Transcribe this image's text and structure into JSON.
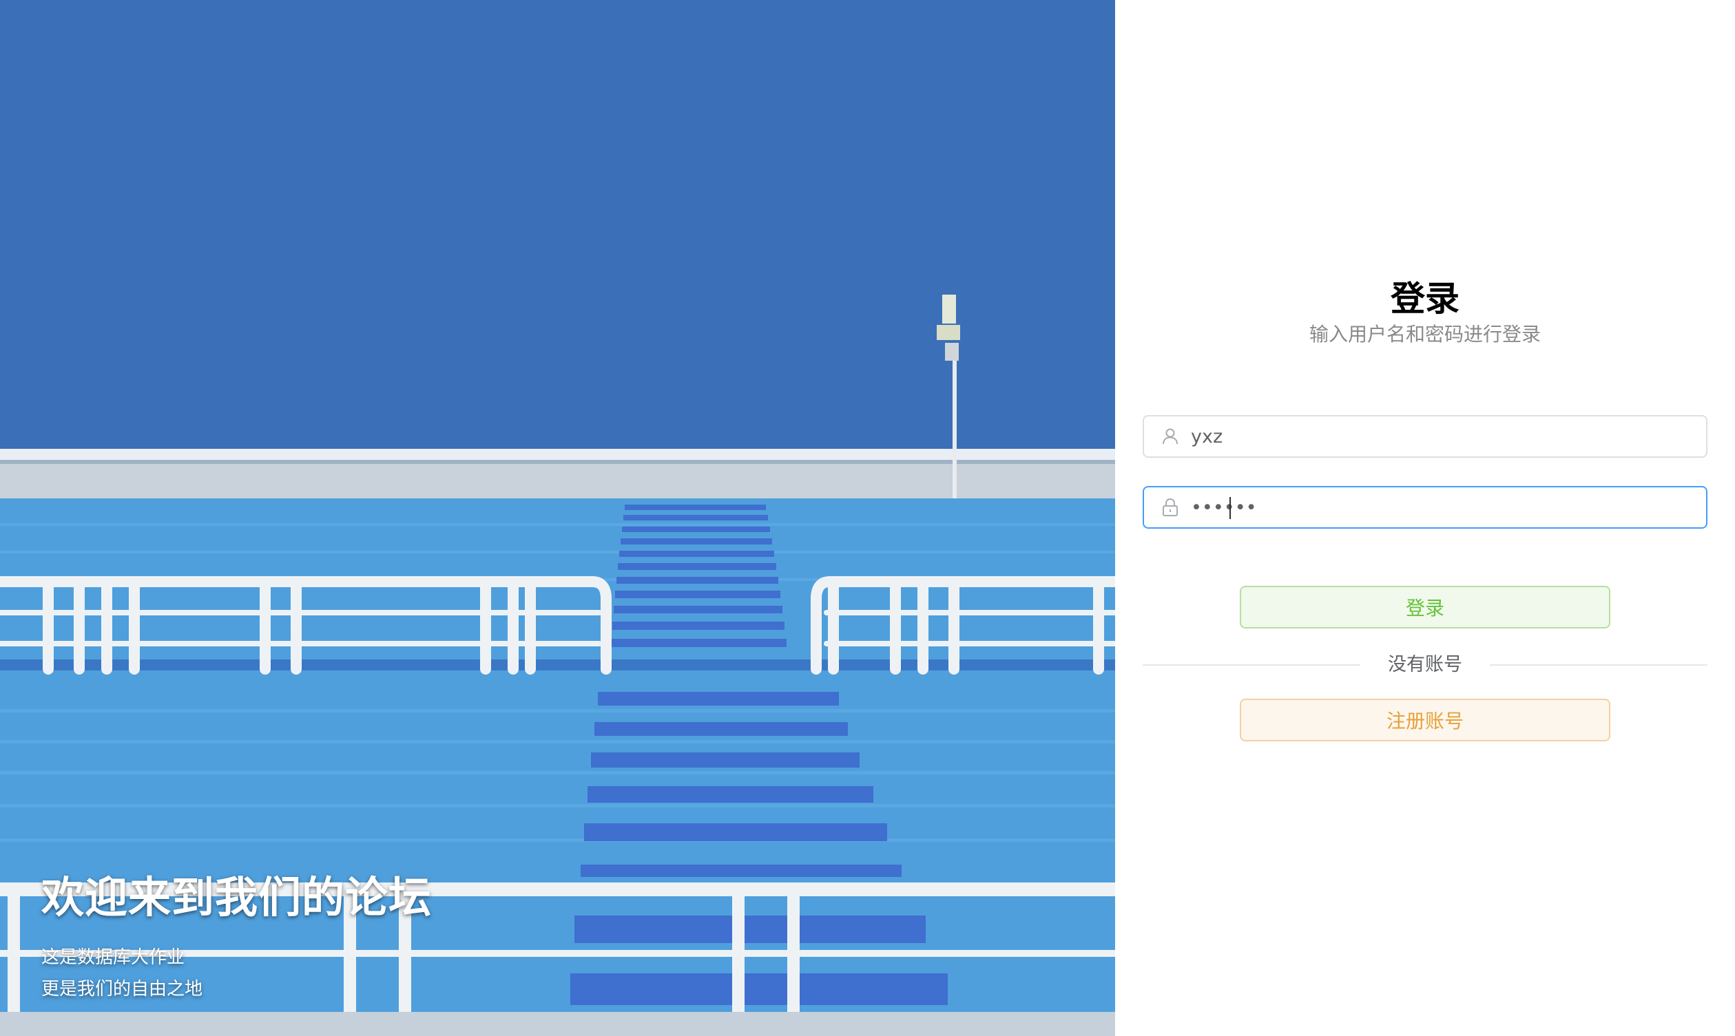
{
  "hero": {
    "title": "欢迎来到我们的论坛",
    "lines": [
      "这是数据库大作业",
      "更是我们的自由之地"
    ]
  },
  "login": {
    "title": "登录",
    "subtitle": "输入用户名和密码进行登录",
    "username": {
      "value": "yxz",
      "icon": "user-icon"
    },
    "password": {
      "value": "••••••",
      "icon": "lock-icon"
    },
    "login_button": "登录",
    "divider_text": "没有账号",
    "register_button": "注册账号"
  },
  "colors": {
    "focus_border": "#409eff",
    "login_button_text": "#67c23a",
    "login_button_bg": "#f0f9eb",
    "register_button_text": "#e6a23c",
    "register_button_bg": "#fdf6ec"
  }
}
